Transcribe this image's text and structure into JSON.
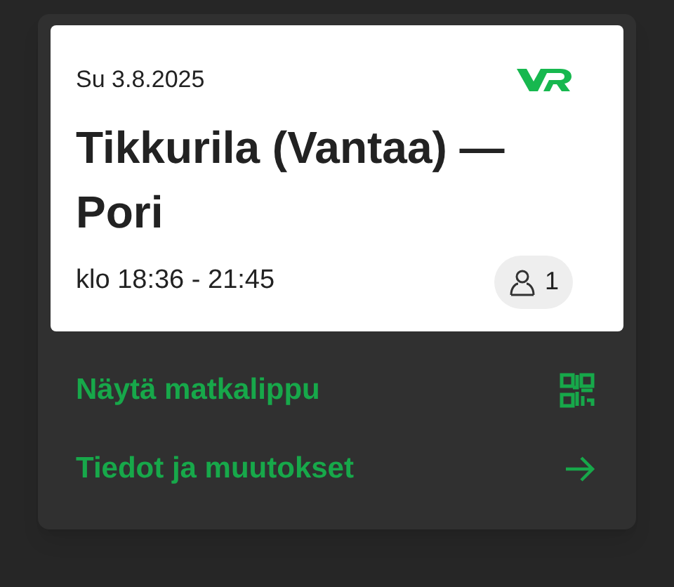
{
  "trip": {
    "date": "Su 3.8.2025",
    "route": "Tikkurila (Vantaa) — Pori",
    "time": "klo 18:36 - 21:45",
    "passengers": "1"
  },
  "actions": [
    {
      "label": "Näytä matkalippu",
      "kind": "qr"
    },
    {
      "label": "Tiedot ja muutokset",
      "kind": "arrow"
    }
  ]
}
